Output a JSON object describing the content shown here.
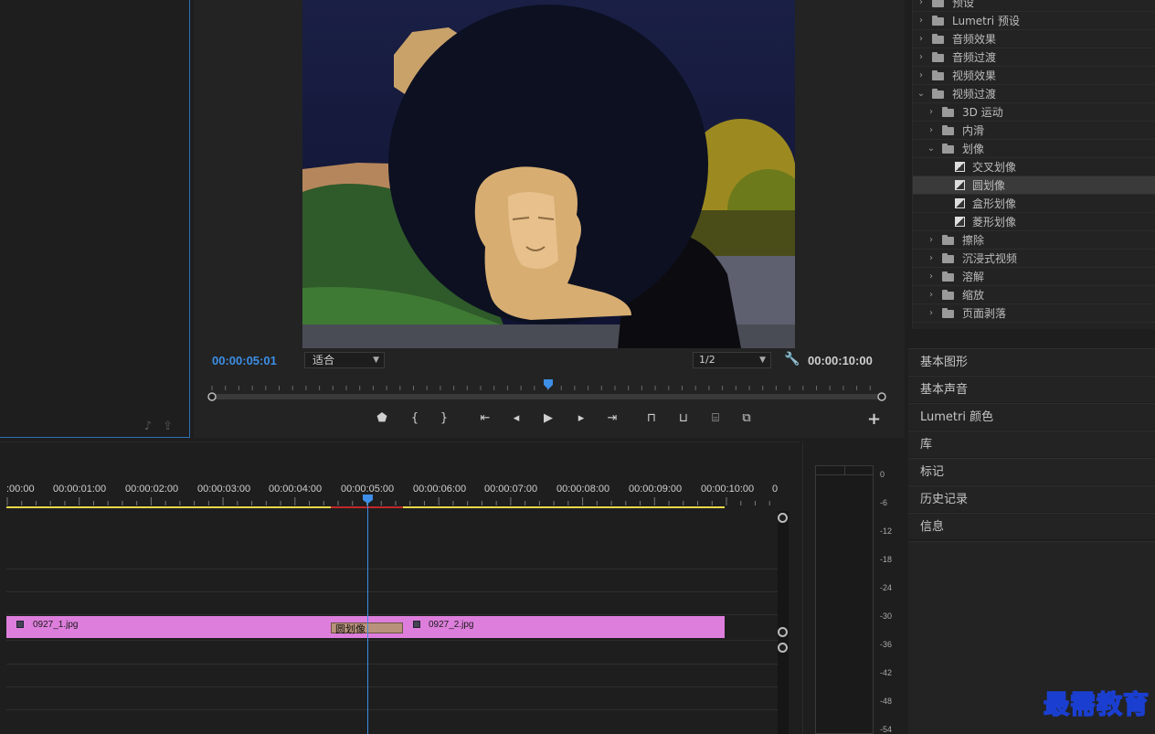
{
  "source_monitor": {
    "icons": [
      "audio-note-icon",
      "export-frame-icon"
    ]
  },
  "program_monitor": {
    "current_time": "00:00:05:01",
    "zoom_value": "适合",
    "resolution_value": "1/2",
    "duration": "00:00:10:00",
    "transport_icons": [
      "add-marker",
      "mark-in",
      "mark-out",
      "go-to-in",
      "step-back",
      "play",
      "step-forward",
      "go-to-out",
      "lift",
      "extract",
      "export-frame",
      "comparison-view"
    ],
    "transport_glyphs": [
      "⬟",
      "{",
      "}",
      "⇤",
      "◂",
      "▶",
      "▸",
      "⇥",
      "⊓",
      "⊔",
      "⌸",
      "⧉"
    ],
    "add_glyph": "+"
  },
  "effects_tree": [
    {
      "label": "预设",
      "level": 0,
      "expanded": false,
      "icon": "preset-folder"
    },
    {
      "label": "Lumetri 预设",
      "level": 0,
      "expanded": false,
      "icon": "preset-folder"
    },
    {
      "label": "音频效果",
      "level": 0,
      "expanded": false,
      "icon": "folder"
    },
    {
      "label": "音频过渡",
      "level": 0,
      "expanded": false,
      "icon": "folder"
    },
    {
      "label": "视频效果",
      "level": 0,
      "expanded": false,
      "icon": "folder"
    },
    {
      "label": "视频过渡",
      "level": 0,
      "expanded": true,
      "icon": "folder"
    },
    {
      "label": "3D 运动",
      "level": 1,
      "expanded": false,
      "icon": "folder"
    },
    {
      "label": "内滑",
      "level": 1,
      "expanded": false,
      "icon": "folder"
    },
    {
      "label": "划像",
      "level": 1,
      "expanded": true,
      "icon": "folder"
    },
    {
      "label": "交叉划像",
      "level": 2,
      "icon": "transition"
    },
    {
      "label": "圆划像",
      "level": 2,
      "icon": "transition",
      "selected": true
    },
    {
      "label": "盒形划像",
      "level": 2,
      "icon": "transition"
    },
    {
      "label": "菱形划像",
      "level": 2,
      "icon": "transition"
    },
    {
      "label": "擦除",
      "level": 1,
      "expanded": false,
      "icon": "folder"
    },
    {
      "label": "沉浸式视频",
      "level": 1,
      "expanded": false,
      "icon": "folder"
    },
    {
      "label": "溶解",
      "level": 1,
      "expanded": false,
      "icon": "folder"
    },
    {
      "label": "缩放",
      "level": 1,
      "expanded": false,
      "icon": "folder"
    },
    {
      "label": "页面剥落",
      "level": 1,
      "expanded": false,
      "icon": "folder"
    }
  ],
  "side_panels": [
    "基本图形",
    "基本声音",
    "Lumetri 颜色",
    "库",
    "标记",
    "历史记录",
    "信息"
  ],
  "timeline": {
    "ruler_labels": [
      ":00:00",
      "00:00:01:00",
      "00:00:02:00",
      "00:00:03:00",
      "00:00:04:00",
      "00:00:05:00",
      "00:00:06:00",
      "00:00:07:00",
      "00:00:08:00",
      "00:00:09:00",
      "00:00:10:00",
      "0"
    ],
    "clip1_name": "0927_1.jpg",
    "clip2_name": "0927_2.jpg",
    "transition_name": "圆划像",
    "colors": {
      "clip": "#de7edc",
      "transition": "#b8927a",
      "playhead": "#3d8ee6",
      "work_area": "#e8d84a",
      "render_red": "#c0282a"
    }
  },
  "audio_meter": {
    "labels": [
      "0",
      "-6",
      "-12",
      "-18",
      "-24",
      "-30",
      "-36",
      "-42",
      "-48",
      "-54"
    ]
  },
  "watermark": "最需教育"
}
